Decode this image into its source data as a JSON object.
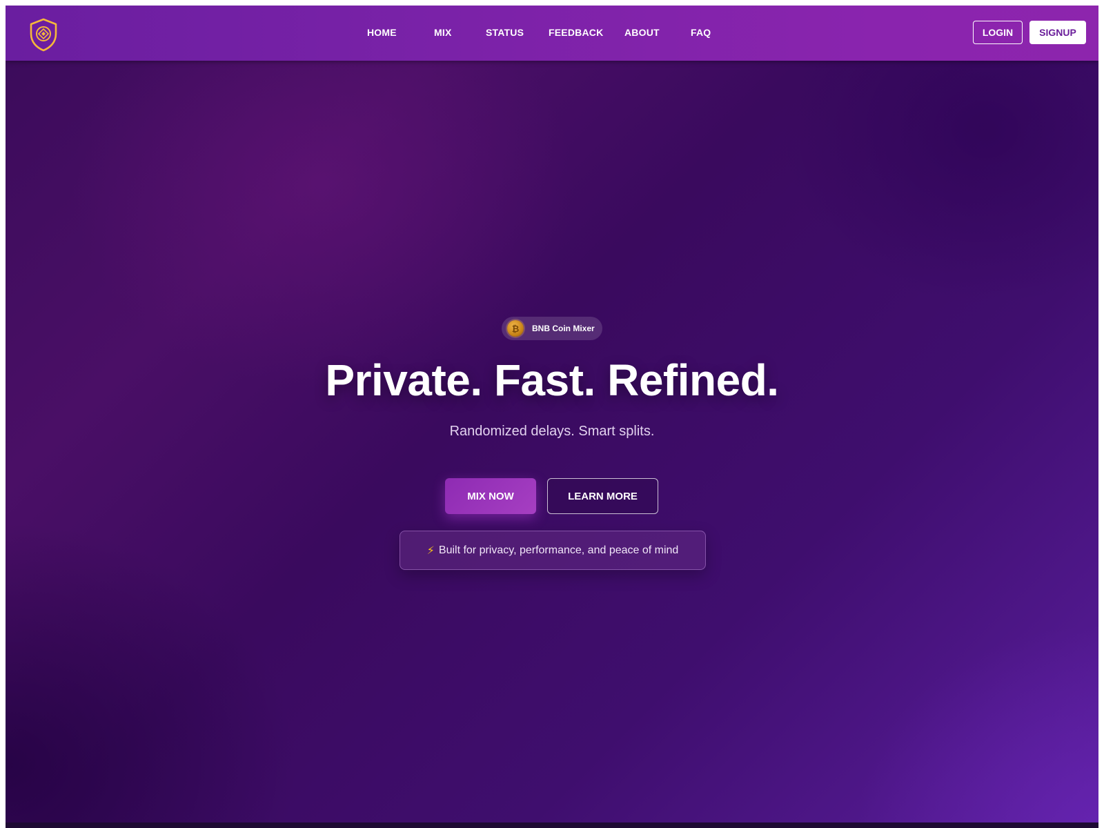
{
  "nav": {
    "items": [
      {
        "label": "HOME"
      },
      {
        "label": "MIX"
      },
      {
        "label": "STATUS"
      },
      {
        "label": "FEEDBACK"
      },
      {
        "label": "ABOUT"
      },
      {
        "label": "FAQ"
      }
    ],
    "login_label": "LOGIN",
    "signup_label": "SIGNUP",
    "logo_icon": "shield-logo-icon"
  },
  "hero": {
    "badge_text": "BNB Coin Mixer",
    "badge_icon": "bitcoin-coin-icon",
    "headline": "Private. Fast. Refined.",
    "subtitle": "Randomized delays. Smart splits.",
    "primary_button": "MIX NOW",
    "secondary_button": "LEARN MORE",
    "tagline_icon": "⚡",
    "tagline_text": "Built for privacy, performance, and peace of mind"
  },
  "colors": {
    "nav_gradient_start": "#6a1ea0",
    "nav_gradient_end": "#8d25ad",
    "hero_background": "#3a0b5a",
    "accent": "#a63fc2",
    "logo_gold": "#f5b83a"
  }
}
